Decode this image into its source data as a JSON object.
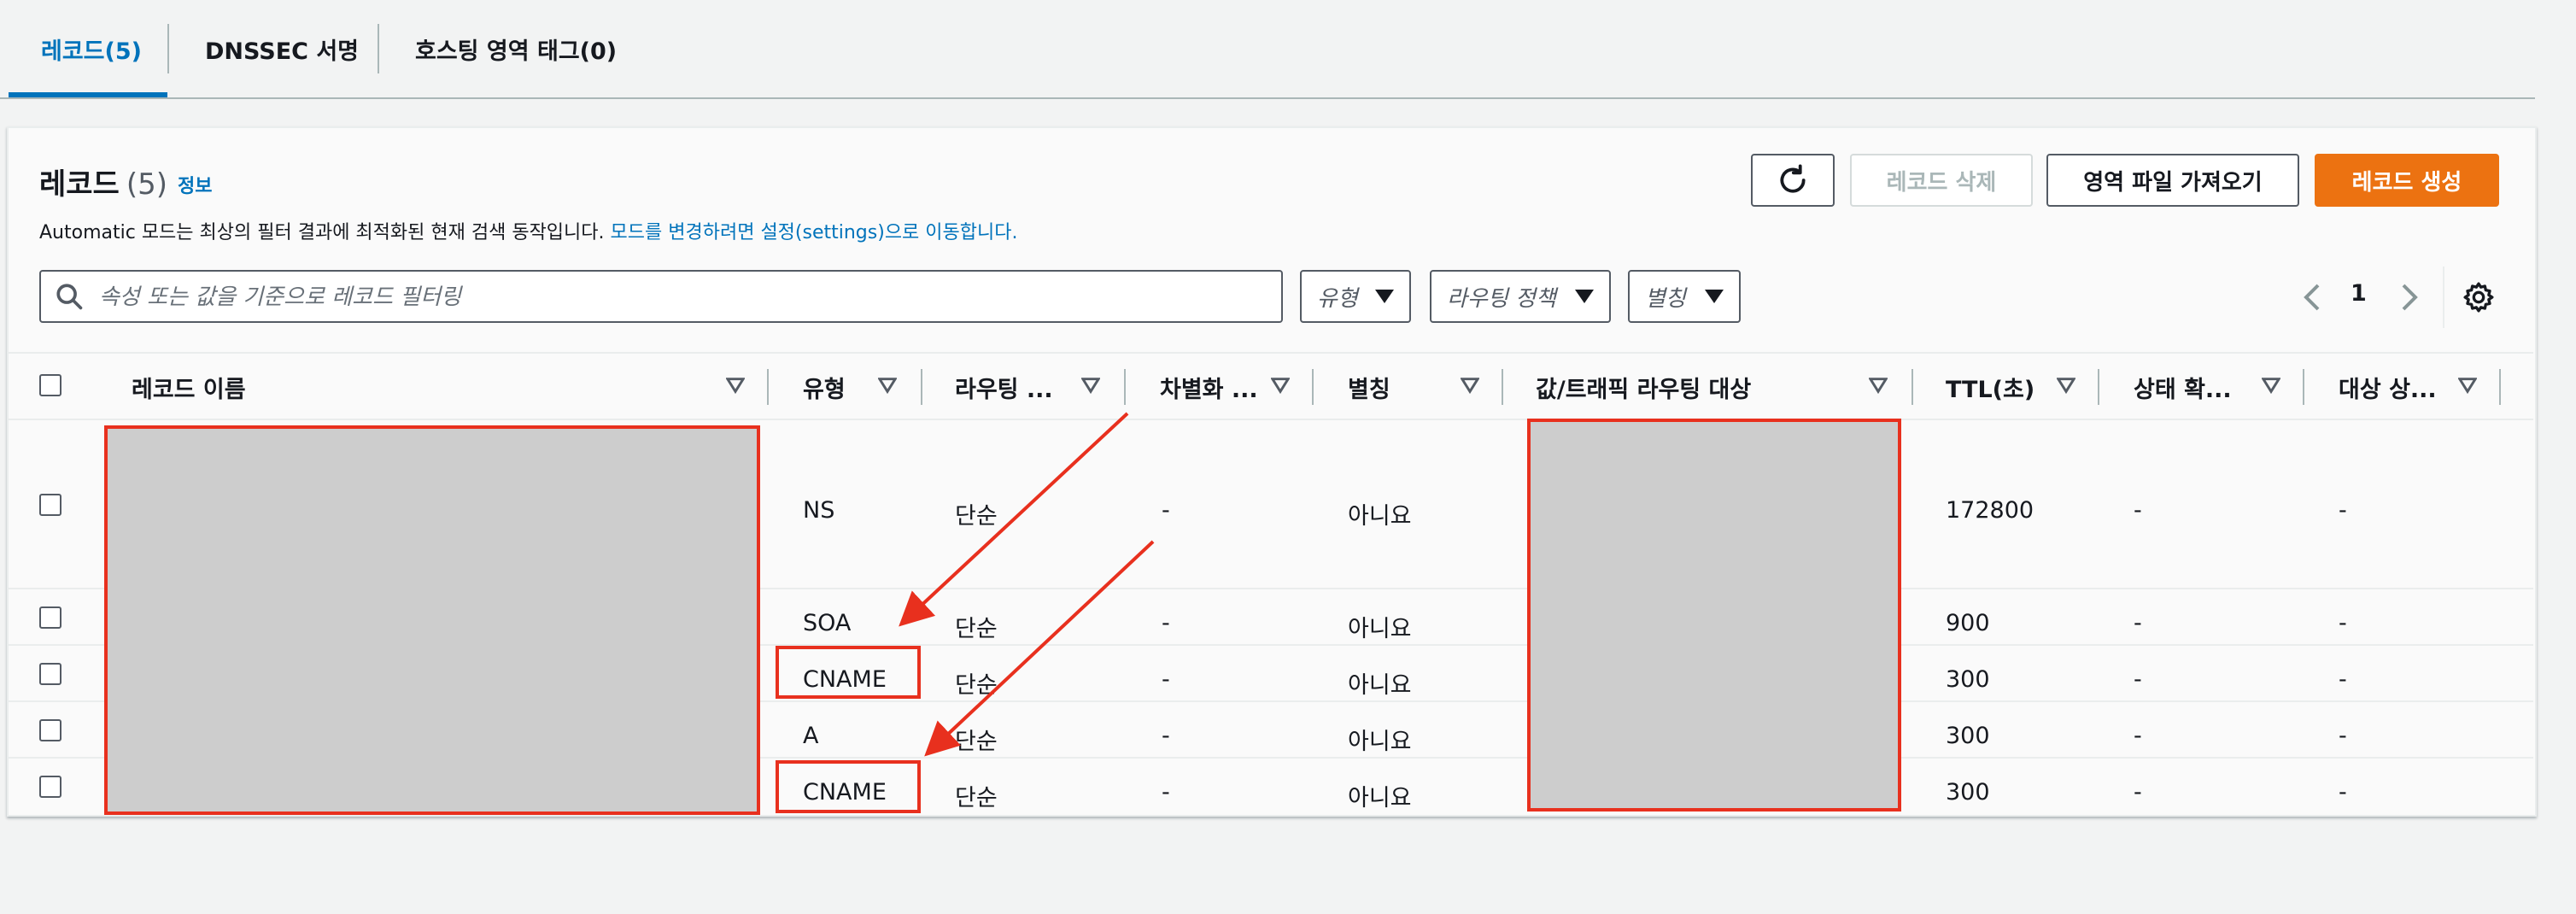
{
  "tabs": [
    {
      "label": "레코드(5)",
      "active": true
    },
    {
      "label": "DNSSEC 서명",
      "active": false
    },
    {
      "label": "호스팅 영역 태그(0)",
      "active": false
    }
  ],
  "header": {
    "title": "레코드",
    "count": "(5)",
    "info_link": "정보",
    "description": "Automatic 모드는 최상의 필터 결과에 최적화된 현재 검색 동작입니다. ",
    "description_link": "모드를 변경하려면 설정(settings)으로 이동합니다."
  },
  "buttons": {
    "refresh_icon": "refresh-icon",
    "delete": "레코드 삭제",
    "import": "영역 파일 가져오기",
    "create": "레코드 생성"
  },
  "filters": {
    "search_placeholder": "속성 또는 값을 기준으로 레코드 필터링",
    "search_icon": "search-icon",
    "type": "유형",
    "routing": "라우팅 정책",
    "alias": "별칭"
  },
  "pagination": {
    "page": "1"
  },
  "columns": [
    "레코드 이름",
    "유형",
    "라우팅 ...",
    "차별화 ...",
    "별칭",
    "값/트래픽 라우팅 대상",
    "TTL(초)",
    "상태 확...",
    "대상 상..."
  ],
  "rows": [
    {
      "type": "NS",
      "routing": "단순",
      "diff": "-",
      "alias": "아니요",
      "ttl": "172800",
      "health": "-",
      "target_health": "-"
    },
    {
      "type": "SOA",
      "routing": "단순",
      "diff": "-",
      "alias": "아니요",
      "ttl": "900",
      "health": "-",
      "target_health": "-"
    },
    {
      "type": "CNAME",
      "routing": "단순",
      "diff": "-",
      "alias": "아니요",
      "ttl": "300",
      "health": "-",
      "target_health": "-"
    },
    {
      "type": "A",
      "routing": "단순",
      "diff": "-",
      "alias": "아니요",
      "ttl": "300",
      "health": "-",
      "target_health": "-"
    },
    {
      "type": "CNAME",
      "routing": "단순",
      "diff": "-",
      "alias": "아니요",
      "ttl": "300",
      "health": "-",
      "target_health": "-"
    }
  ],
  "colors": {
    "accent": "#0073bb",
    "primary_button": "#ec7211",
    "annotation": "#e8301e",
    "redaction": "#cdcdcd"
  }
}
